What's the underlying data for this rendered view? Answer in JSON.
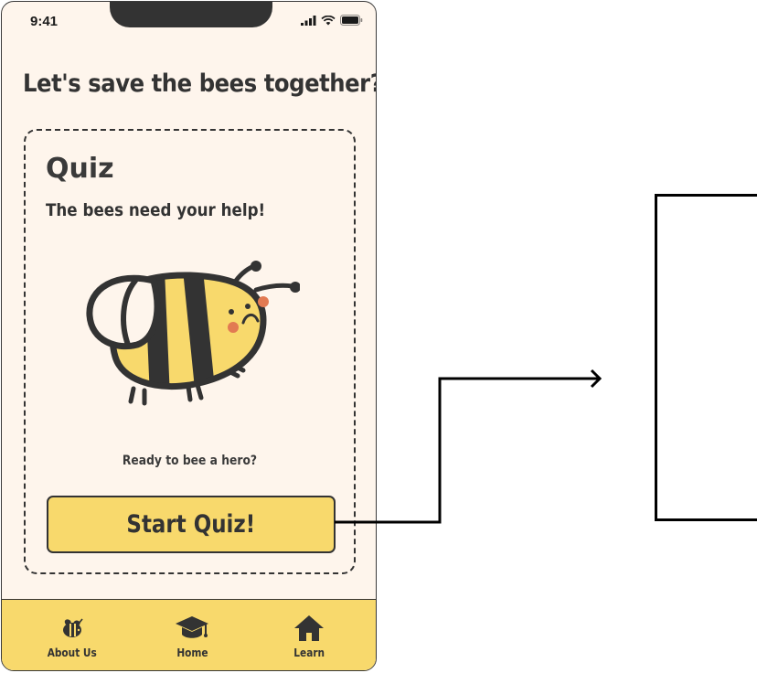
{
  "status_bar": {
    "time": "9:41"
  },
  "headline": "Let's save the bees together?",
  "quiz_card": {
    "title": "Quiz",
    "subtitle": "The bees need your help!",
    "prompt": "Ready to bee a hero?",
    "start_button_label": "Start Quiz!"
  },
  "tab_bar": {
    "tabs": [
      {
        "label": "About Us",
        "icon": "bee-icon"
      },
      {
        "label": "Home",
        "icon": "graduation-cap-icon"
      },
      {
        "label": "Learn",
        "icon": "house-icon"
      }
    ]
  },
  "colors": {
    "background": "#FEF5EC",
    "accent_yellow": "#F8D96C",
    "ink": "#333333",
    "cheek": "#E27A52"
  }
}
